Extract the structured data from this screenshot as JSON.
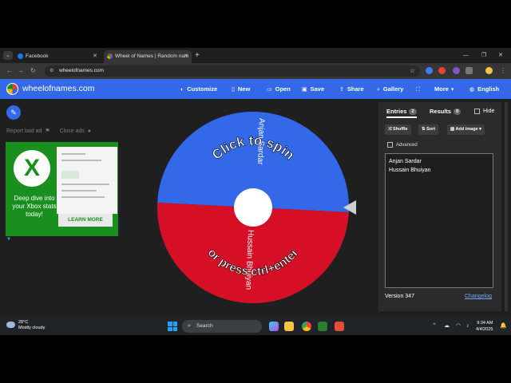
{
  "browser": {
    "tabs": [
      {
        "title": "Facebook",
        "favicon_color": "#1877f2"
      },
      {
        "title": "Wheel of Names | Random nam",
        "favicon_color": "#e94235"
      }
    ],
    "url": "wheelofnames.com"
  },
  "header": {
    "brand": "wheelofnames.com",
    "menu": [
      {
        "label": "Customize",
        "icon": "palette-icon"
      },
      {
        "label": "New",
        "icon": "new-file-icon"
      },
      {
        "label": "Open",
        "icon": "folder-icon"
      },
      {
        "label": "Save",
        "icon": "save-icon"
      },
      {
        "label": "Share",
        "icon": "share-icon"
      },
      {
        "label": "Gallery",
        "icon": "gallery-icon"
      },
      {
        "label": "",
        "icon": "fullscreen-icon"
      },
      {
        "label": "More",
        "icon": "chevron-down-icon"
      },
      {
        "label": "English",
        "icon": "globe-icon"
      }
    ]
  },
  "ads": {
    "report_label": "Report bad ad",
    "close_label": "Close ads",
    "ad_text": "Deep dive into your Xbox stats today!",
    "ad_cta": "LEARN MORE"
  },
  "wheel": {
    "prompt_top": "Click to spin",
    "prompt_bottom": "or press ctrl+enter",
    "segments": [
      {
        "name": "Anjan Sardar",
        "color": "#3369e8"
      },
      {
        "name": "Hussain Bhuiyan",
        "color": "#d50f25"
      }
    ]
  },
  "panel": {
    "entries_tab": "Entries",
    "entries_count": "2",
    "results_tab": "Results",
    "results_count": "0",
    "hide_label": "Hide",
    "shuffle_label": "Shuffle",
    "sort_label": "Sort",
    "add_image_label": "Add image",
    "advanced_label": "Advanced",
    "entries": [
      "Anjan Sardar",
      "Hussain Bhuiyan"
    ],
    "version": "Version 347",
    "changelog": "Changelog"
  },
  "taskbar": {
    "temperature": "28°C",
    "weather": "Mostly cloudy",
    "search_placeholder": "Search",
    "time": "9:34 AM",
    "date": "4/4/2025"
  }
}
